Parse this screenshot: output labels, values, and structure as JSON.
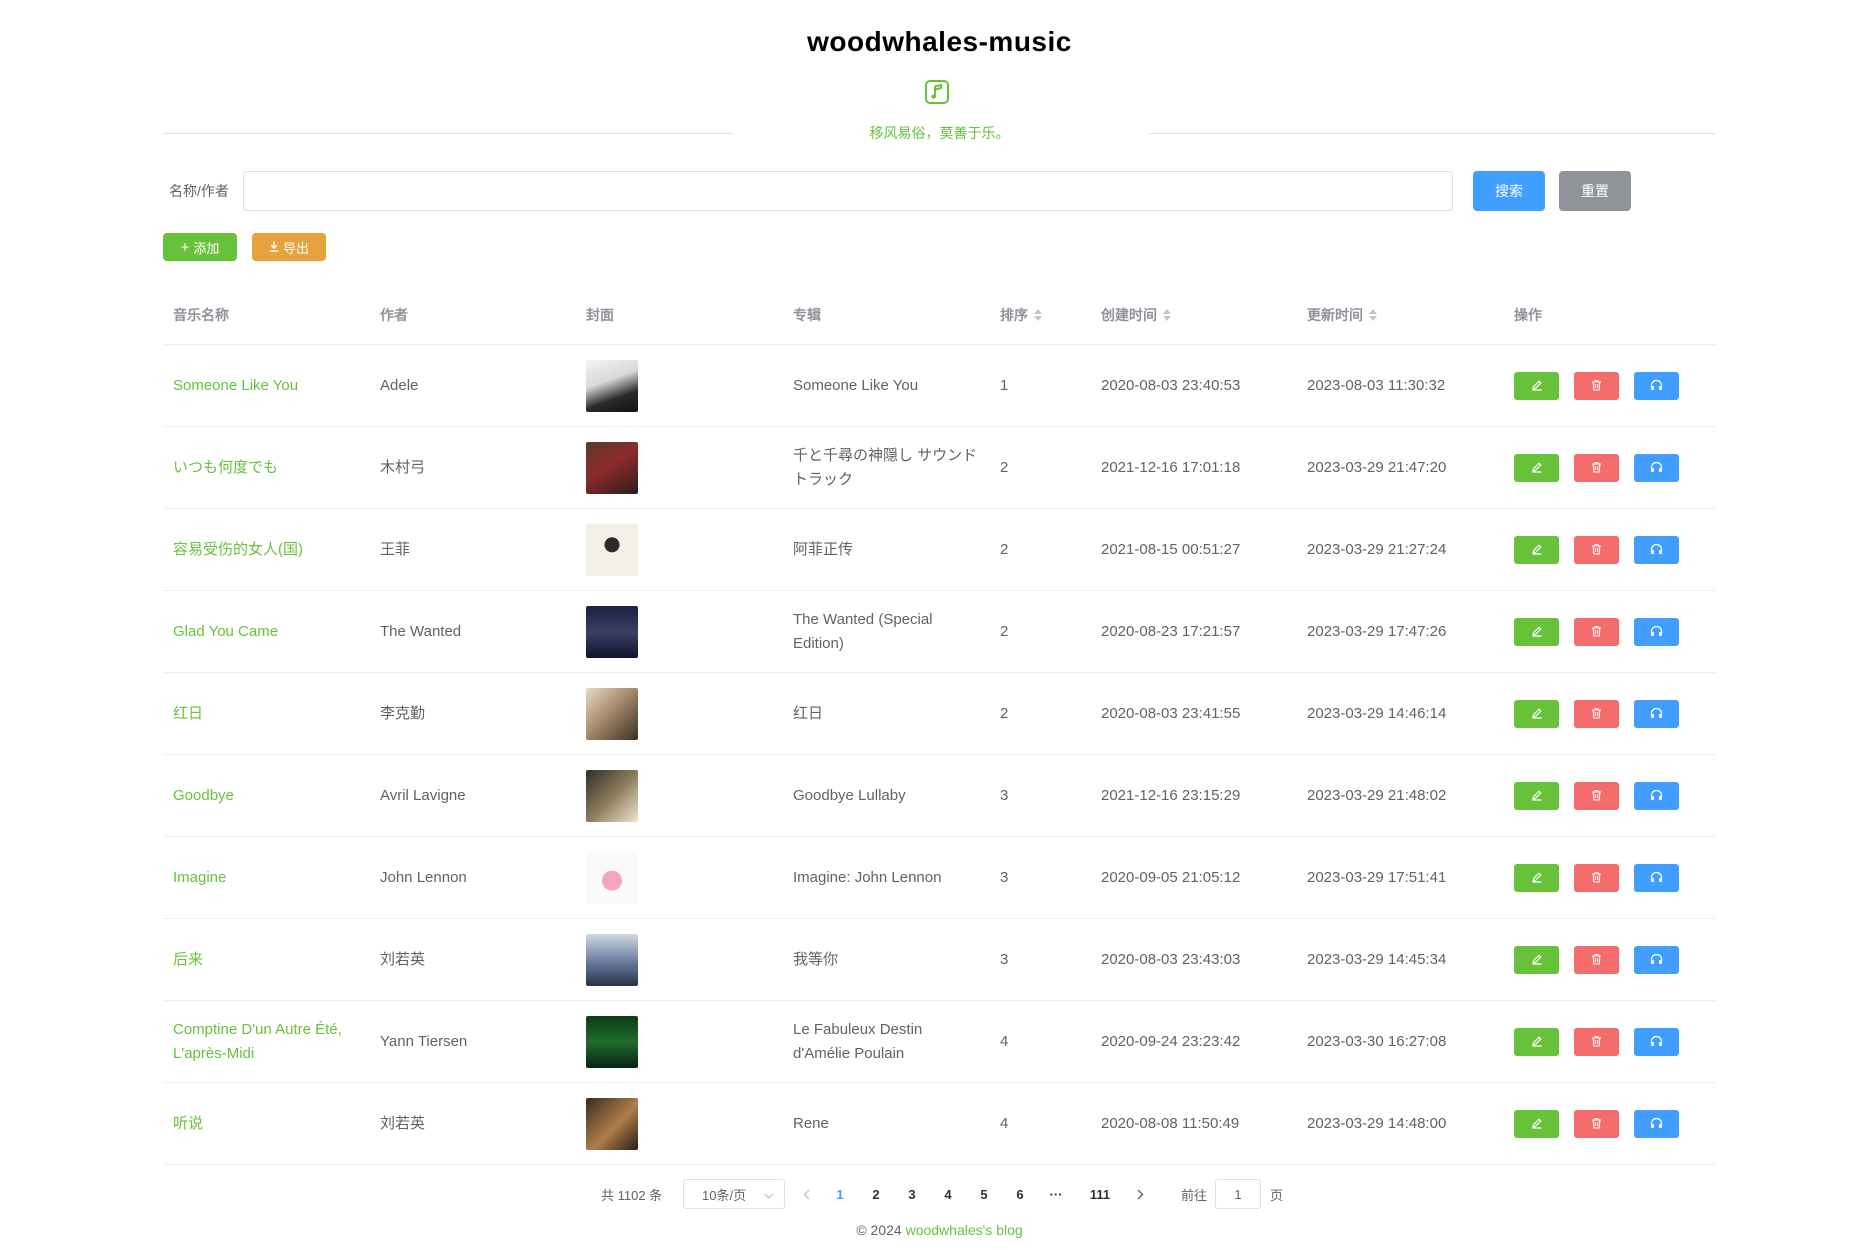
{
  "header": {
    "title": "woodwhales-music",
    "subtitle": "移风易俗，莫善于乐。",
    "accent_color": "#67c23a"
  },
  "search": {
    "label": "名称/作者",
    "value": "",
    "placeholder": "",
    "search_label": "搜索",
    "reset_label": "重置"
  },
  "toolbar": {
    "add_label": "添加",
    "export_label": "导出"
  },
  "table": {
    "columns": [
      "音乐名称",
      "作者",
      "封面",
      "专辑",
      "排序",
      "创建时间",
      "更新时间",
      "操作"
    ],
    "rows": [
      {
        "name": "Someone Like You",
        "artist": "Adele",
        "album": "Someone Like You",
        "sort": "1",
        "created": "2020-08-03 23:40:53",
        "updated": "2023-08-03 11:30:32"
      },
      {
        "name": "いつも何度でも",
        "artist": "木村弓",
        "album": "千と千尋の神隠し サウンドトラック",
        "sort": "2",
        "created": "2021-12-16 17:01:18",
        "updated": "2023-03-29 21:47:20"
      },
      {
        "name": "容易受伤的女人(国)",
        "artist": "王菲",
        "album": "阿菲正传",
        "sort": "2",
        "created": "2021-08-15 00:51:27",
        "updated": "2023-03-29 21:27:24"
      },
      {
        "name": "Glad You Came",
        "artist": "The Wanted",
        "album": "The Wanted (Special Edition)",
        "sort": "2",
        "created": "2020-08-23 17:21:57",
        "updated": "2023-03-29 17:47:26"
      },
      {
        "name": "红日",
        "artist": "李克勤",
        "album": "红日",
        "sort": "2",
        "created": "2020-08-03 23:41:55",
        "updated": "2023-03-29 14:46:14"
      },
      {
        "name": "Goodbye",
        "artist": "Avril Lavigne",
        "album": "Goodbye Lullaby",
        "sort": "3",
        "created": "2021-12-16 23:15:29",
        "updated": "2023-03-29 21:48:02"
      },
      {
        "name": "Imagine",
        "artist": "John Lennon",
        "album": "Imagine: John Lennon",
        "sort": "3",
        "created": "2020-09-05 21:05:12",
        "updated": "2023-03-29 17:51:41"
      },
      {
        "name": "后来",
        "artist": "刘若英",
        "album": "我等你",
        "sort": "3",
        "created": "2020-08-03 23:43:03",
        "updated": "2023-03-29 14:45:34"
      },
      {
        "name": "Comptine D'un Autre Été, L'après-Midi",
        "artist": "Yann Tiersen",
        "album": "Le Fabuleux Destin d'Amélie Poulain",
        "sort": "4",
        "created": "2020-09-24 23:23:42",
        "updated": "2023-03-30 16:27:08"
      },
      {
        "name": "听说",
        "artist": "刘若英",
        "album": "Rene",
        "sort": "4",
        "created": "2020-08-08 11:50:49",
        "updated": "2023-03-29 14:48:00"
      }
    ]
  },
  "pagination": {
    "total_text": "共 1102 条",
    "page_size": "10条/页",
    "pages": [
      "1",
      "2",
      "3",
      "4",
      "5",
      "6",
      "···",
      "111"
    ],
    "current_page": "1",
    "goto_label": "前往",
    "goto_value": "1",
    "page_suffix": "页"
  },
  "footer": {
    "copyright": "©  2024",
    "link_text": "woodwhales's blog"
  }
}
